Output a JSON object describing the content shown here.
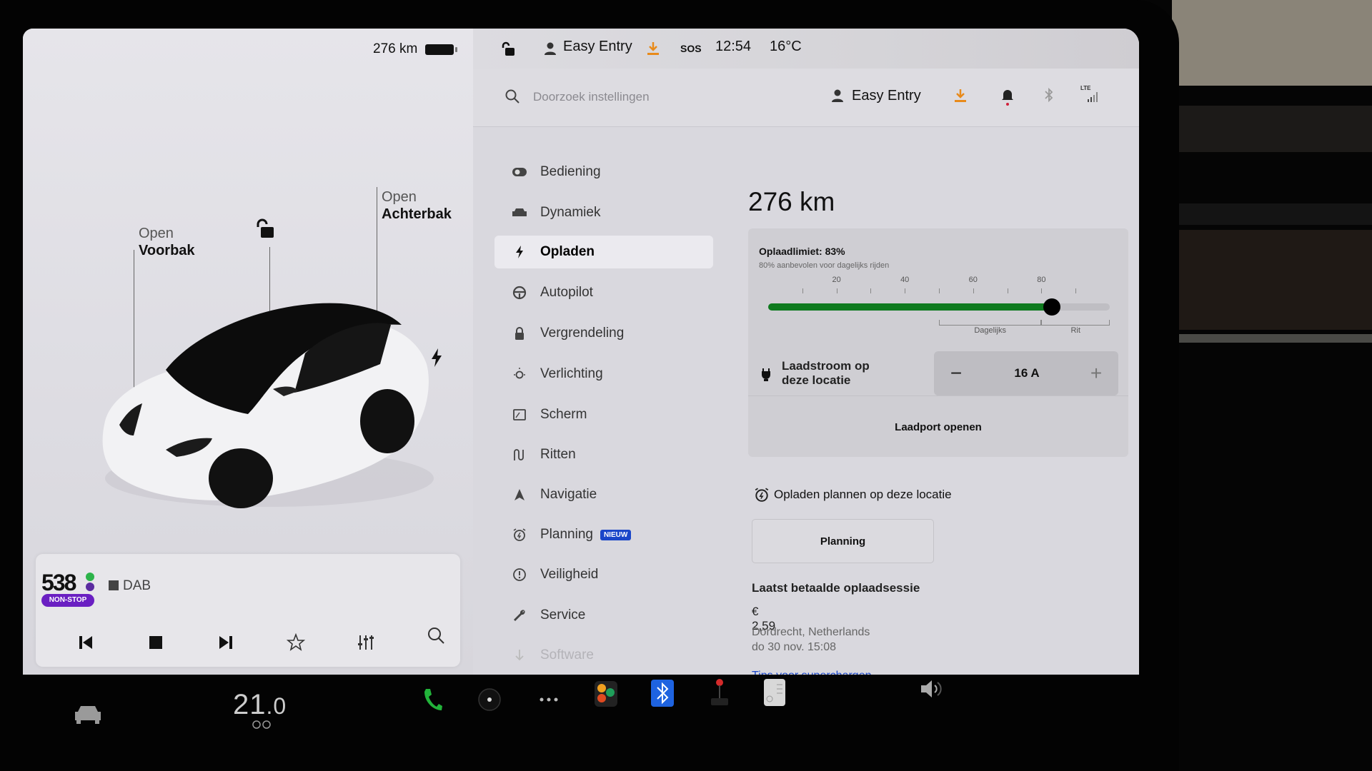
{
  "status_bar": {
    "range": "276 km",
    "battery_level_percent": 83,
    "profile": "Easy Entry",
    "sos_label": "SOS",
    "time": "12:54",
    "temperature": "16°C"
  },
  "car_view": {
    "frunk": {
      "line1": "Open",
      "line2": "Voorbak"
    },
    "trunk": {
      "line1": "Open",
      "line2": "Achterbak"
    },
    "lock_state": "unlocked",
    "charge_port_icon": "bolt-icon"
  },
  "media": {
    "station_name": "538",
    "station_sub": "NON-STOP",
    "source": "DAB",
    "controls": [
      "previous",
      "stop",
      "next",
      "favorite",
      "equalizer",
      "search"
    ]
  },
  "settings_header": {
    "search_placeholder": "Doorzoek instellingen",
    "profile": "Easy Entry",
    "icons": [
      "download-icon",
      "bell-icon",
      "bluetooth-icon",
      "lte-signal-icon"
    ],
    "lte_label": "LTE"
  },
  "menu": {
    "items": [
      {
        "label": "Bediening",
        "icon": "toggle-icon"
      },
      {
        "label": "Dynamiek",
        "icon": "car-icon"
      },
      {
        "label": "Opladen",
        "icon": "bolt-icon",
        "active": true
      },
      {
        "label": "Autopilot",
        "icon": "steering-wheel-icon"
      },
      {
        "label": "Vergrendeling",
        "icon": "lock-icon"
      },
      {
        "label": "Verlichting",
        "icon": "light-icon"
      },
      {
        "label": "Scherm",
        "icon": "display-icon"
      },
      {
        "label": "Ritten",
        "icon": "trips-icon"
      },
      {
        "label": "Navigatie",
        "icon": "navigation-icon"
      },
      {
        "label": "Planning",
        "icon": "alarm-clock-icon",
        "badge": "NIEUW"
      },
      {
        "label": "Veiligheid",
        "icon": "alert-circle-icon"
      },
      {
        "label": "Service",
        "icon": "wrench-icon"
      },
      {
        "label": "Software",
        "icon": "download-arrow-icon"
      }
    ]
  },
  "charging": {
    "range": "276 km",
    "limit_title": "Oplaadlimiet: 83%",
    "limit_value_percent": 83,
    "limit_subtitle": "80% aanbevolen voor dagelijks rijden",
    "scale_labels": [
      "20",
      "40",
      "60",
      "80"
    ],
    "zone_daily": "Dagelijks",
    "zone_trip": "Rit",
    "current_label": "Laadstroom op deze locatie",
    "current_value": "16 A",
    "minus": "−",
    "plus": "+",
    "port_button": "Laadport openen",
    "schedule_title": "Opladen plannen op deze locatie",
    "planning_button": "Planning",
    "last_session_title": "Laatst betaalde oplaadsessie",
    "last_session_amount": "€ 2,59",
    "last_session_location": "Dordrecht, Netherlands",
    "last_session_date": "do 30 nov. 15:08",
    "tips_link": "Tips voor superchargen"
  },
  "taskbar": {
    "temperature_whole": "21",
    "temperature_decimal": ".0",
    "apps": [
      "phone-icon",
      "camera-icon",
      "more-icon",
      "games-icon",
      "bluetooth-icon",
      "joystick-icon",
      "calendar-icon"
    ],
    "volume_icon": "volume-icon"
  },
  "colors": {
    "charge_green": "#0e7a1e",
    "badge_blue": "#1a46c9",
    "link_blue": "#1a46c9",
    "download_orange": "#e88a1a",
    "radio_purple": "#6a1fc2",
    "phone_green": "#22b33a"
  }
}
